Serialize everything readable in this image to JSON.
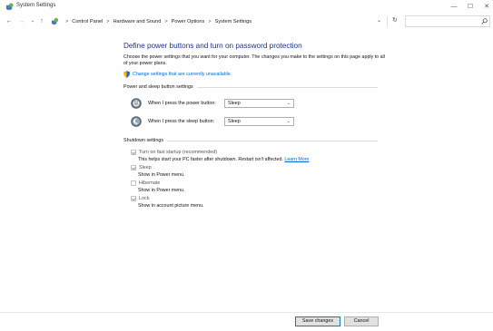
{
  "window": {
    "title": "System Settings",
    "controls": {
      "minimize": "—",
      "maximize": "☐",
      "close": "✕"
    }
  },
  "address": {
    "crumbs": [
      "Control Panel",
      "Hardware and Sound",
      "Power Options",
      "System Settings"
    ],
    "separator": ">",
    "dropdown_glyph": "⌄",
    "refresh_glyph": "↻",
    "search_placeholder": ""
  },
  "nav": {
    "back": "←",
    "forward": "→",
    "recent": "⌄",
    "up": "↑"
  },
  "content": {
    "title": "Define power buttons and turn on password protection",
    "description": "Choose the power settings that you want for your computer. The changes you make to the settings on this page apply to all of your power plans.",
    "change_link": "Change settings that are currently unavailable"
  },
  "power_group": {
    "header": "Power and sleep button settings",
    "rows": [
      {
        "label": "When I press the power button:",
        "value": "Sleep"
      },
      {
        "label": "When I press the sleep button:",
        "value": "Sleep"
      }
    ]
  },
  "shutdown_group": {
    "header": "Shutdown settings",
    "items": [
      {
        "label": "Turn on fast startup (recommended)",
        "checked": true,
        "desc": "This helps start your PC faster after shutdown. Restart isn't affected.",
        "link": "Learn More"
      },
      {
        "label": "Sleep",
        "checked": true,
        "desc": "Show in Power menu."
      },
      {
        "label": "Hibernate",
        "checked": false,
        "desc": "Show in Power menu."
      },
      {
        "label": "Lock",
        "checked": true,
        "desc": "Show in account picture menu."
      }
    ]
  },
  "footer": {
    "save": "Save changes",
    "cancel": "Cancel"
  },
  "colors": {
    "title_blue": "#1e3287",
    "link_blue": "#0066cc",
    "accent": "#0078d7"
  }
}
